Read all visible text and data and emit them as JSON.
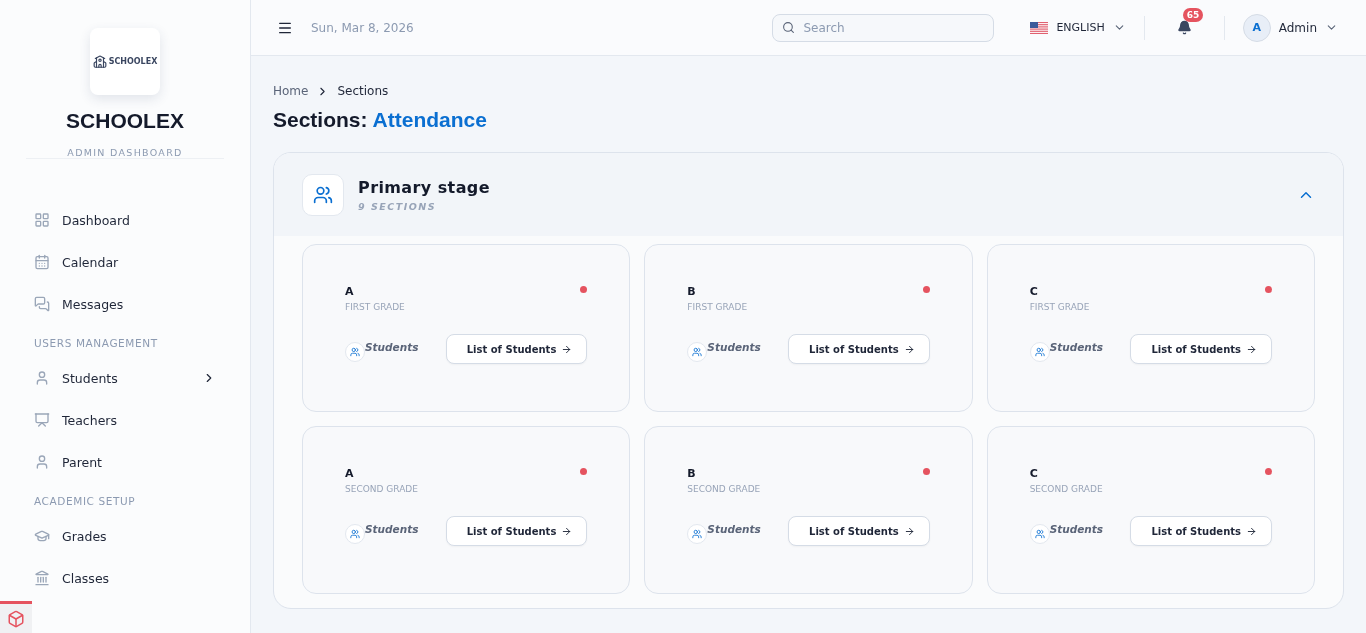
{
  "brand": {
    "name": "SCHOOLEX",
    "subtitle": "ADMIN DASHBOARD",
    "logo_text": "SCHOOLEX"
  },
  "sidebar": {
    "items": [
      {
        "kind": "item",
        "label": "Dashboard",
        "has_submenu": false
      },
      {
        "kind": "item",
        "label": "Calendar",
        "has_submenu": false
      },
      {
        "kind": "item",
        "label": "Messages",
        "has_submenu": false
      },
      {
        "kind": "heading",
        "label": "USERS MANAGEMENT"
      },
      {
        "kind": "item",
        "label": "Students",
        "has_submenu": true
      },
      {
        "kind": "item",
        "label": "Teachers",
        "has_submenu": false
      },
      {
        "kind": "item",
        "label": "Parent",
        "has_submenu": false
      },
      {
        "kind": "heading",
        "label": "ACADEMIC SETUP"
      },
      {
        "kind": "item",
        "label": "Grades",
        "has_submenu": false
      },
      {
        "kind": "item",
        "label": "Classes",
        "has_submenu": false
      }
    ]
  },
  "topbar": {
    "date": "Sun, Mar 8, 2026",
    "search": {
      "placeholder": "Search"
    },
    "language": "ENGLISH",
    "notifications": "65",
    "user": {
      "initial": "A",
      "name": "Admin"
    }
  },
  "breadcrumb": [
    {
      "label": "Home",
      "current": false
    },
    {
      "label": "Sections",
      "current": true
    }
  ],
  "page_title": {
    "prefix": "Sections:",
    "highlight": "Attendance"
  },
  "stage": {
    "title": "Primary stage",
    "count": "9 SECTIONS",
    "expanded": true,
    "sections": [
      {
        "name": "A",
        "grade": "FIRST GRADE",
        "students_label": "Students",
        "button": "List of Students"
      },
      {
        "name": "B",
        "grade": "FIRST GRADE",
        "students_label": "Students",
        "button": "List of Students"
      },
      {
        "name": "C",
        "grade": "FIRST GRADE",
        "students_label": "Students",
        "button": "List of Students"
      },
      {
        "name": "A",
        "grade": "SECOND GRADE",
        "students_label": "Students",
        "button": "List of Students"
      },
      {
        "name": "B",
        "grade": "SECOND GRADE",
        "students_label": "Students",
        "button": "List of Students"
      },
      {
        "name": "C",
        "grade": "SECOND GRADE",
        "students_label": "Students",
        "button": "List of Students"
      }
    ]
  }
}
